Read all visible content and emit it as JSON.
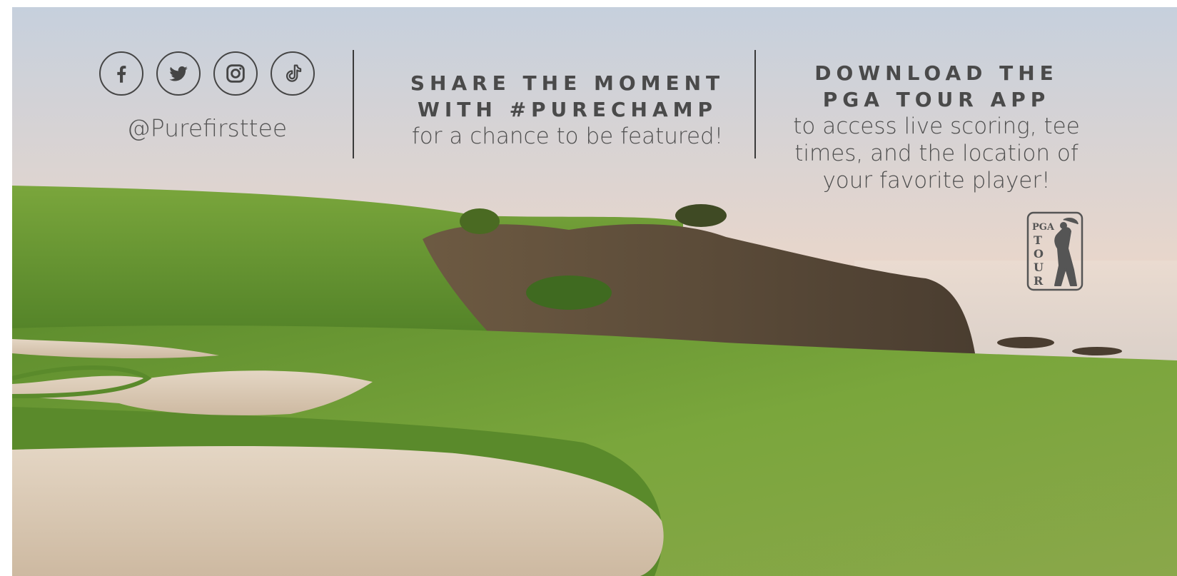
{
  "social": {
    "icons": [
      "facebook-icon",
      "twitter-icon",
      "instagram-icon",
      "tiktok-icon"
    ],
    "handle": "@Purefirsttee"
  },
  "share": {
    "headline_line1": "SHARE THE MOMENT",
    "headline_line2": "WITH #PURECHAMP",
    "subtext": "for a chance to be featured!"
  },
  "app": {
    "headline_line1": "DOWNLOAD THE",
    "headline_line2": "PGA TOUR APP",
    "subtext_line1": "to access live scoring, tee",
    "subtext_line2": "times, and the location of",
    "subtext_line3": "your favorite player!"
  },
  "logo": {
    "name": "pga-tour-logo",
    "text_top": "PGA",
    "text_vertical": "TOUR"
  },
  "colors": {
    "text": "#4a4a4a",
    "sky_top": "#c9d2de",
    "sky_bottom": "#f5c9a0",
    "grass": "#6f9a3a",
    "sand": "#d9c8b2"
  }
}
